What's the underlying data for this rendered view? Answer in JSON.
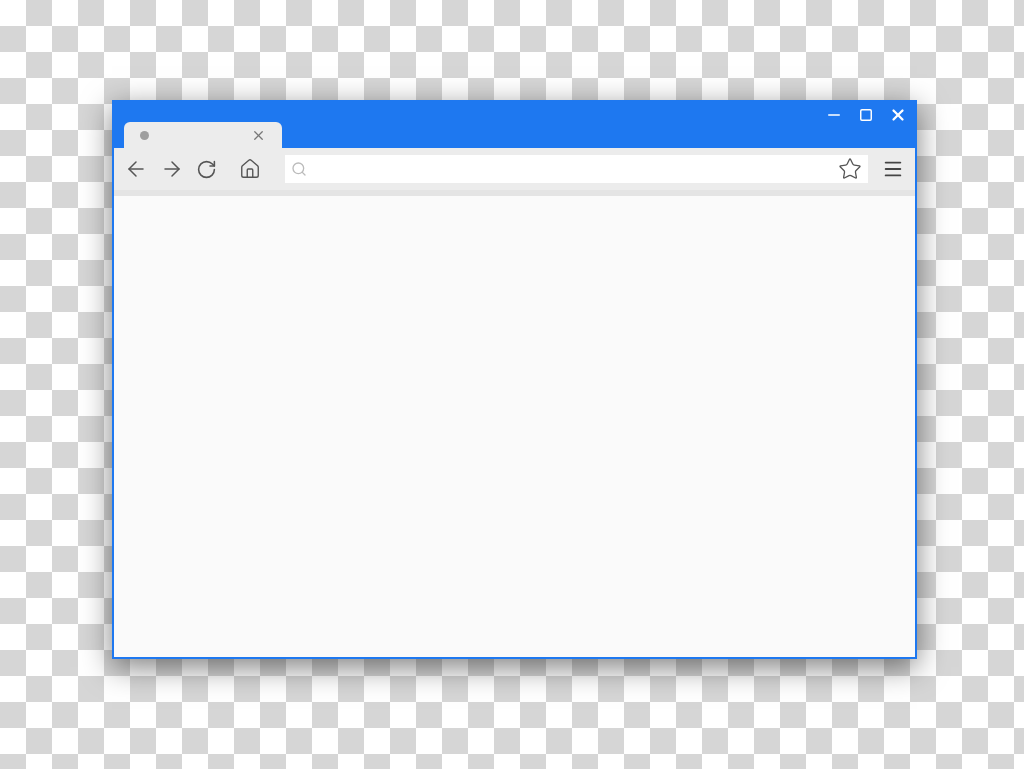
{
  "tabs": [
    {
      "selected": true
    }
  ],
  "address_bar": {
    "bookmarked": false
  }
}
